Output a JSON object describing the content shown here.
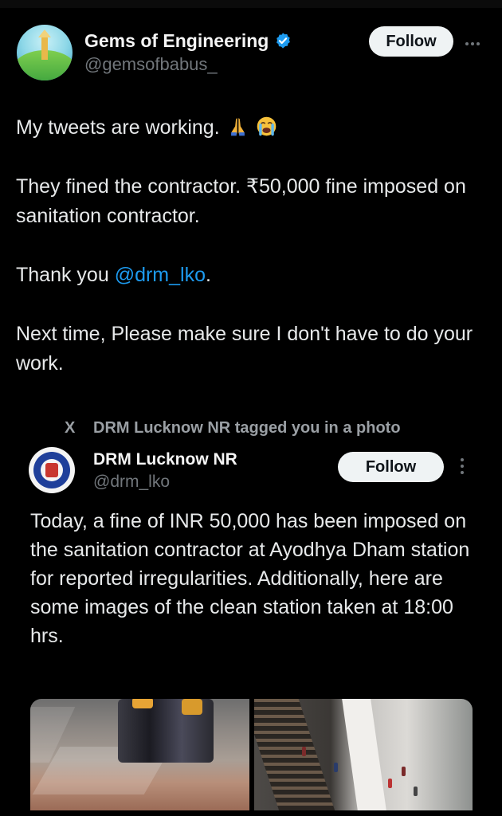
{
  "tweet": {
    "author_name": "Gems of Engineering",
    "author_handle": "@gemsofbabus_",
    "follow_label": "Follow",
    "line1": "My tweets are working.",
    "line2": "They fined the contractor. ₹50,000 fine imposed on sanitation contractor.",
    "line3_prefix": "Thank you ",
    "line3_mention": "@drm_lko",
    "line3_suffix": ".",
    "line4": "Next time, Please make sure I don't have to do your work."
  },
  "quoted": {
    "context_icon": "X",
    "context_text": "DRM Lucknow NR tagged you in a photo",
    "author_name": "DRM Lucknow NR",
    "author_handle": "@drm_lko",
    "follow_label": "Follow",
    "text": "Today, a fine of INR 50,000 has been imposed on the sanitation contractor at Ayodhya Dham station for reported irregularities. Additionally, here are some images of the clean station taken at 18:00 hrs."
  },
  "colors": {
    "background": "#000000",
    "text": "#e7e9ea",
    "muted": "#71767b",
    "link": "#1d9bf0",
    "verified": "#1d9bf0",
    "button_bg": "#eff3f4"
  },
  "icons": {
    "verified": "verified-badge-icon",
    "more_horizontal": "more-horizontal-icon",
    "more_vertical": "more-vertical-icon",
    "pray_emoji": "folded-hands-emoji",
    "cry_emoji": "loudly-crying-face-emoji",
    "x_logo": "x-logo-icon"
  }
}
